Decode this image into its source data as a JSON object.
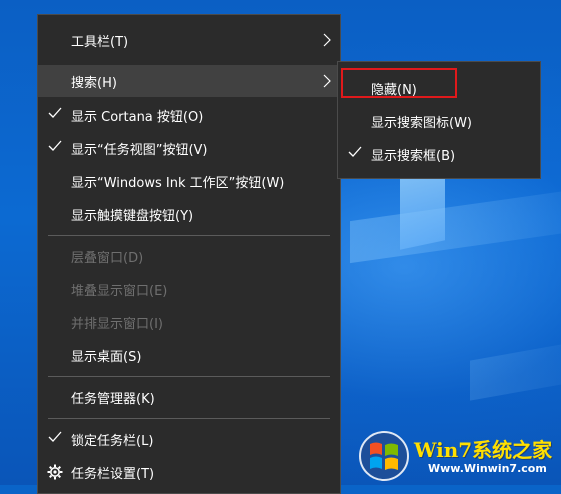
{
  "menu": {
    "items": [
      {
        "label": "工具栏(T)",
        "checked": false,
        "submenu": true,
        "disabled": false
      },
      {
        "label": "搜索(H)",
        "checked": false,
        "submenu": true,
        "disabled": false,
        "hovered": true
      },
      {
        "label": "显示 Cortana 按钮(O)",
        "checked": true,
        "submenu": false,
        "disabled": false
      },
      {
        "label": "显示“任务视图”按钮(V)",
        "checked": true,
        "submenu": false,
        "disabled": false
      },
      {
        "label": "显示“Windows Ink 工作区”按钮(W)",
        "checked": false,
        "submenu": false,
        "disabled": false
      },
      {
        "label": "显示触摸键盘按钮(Y)",
        "checked": false,
        "submenu": false,
        "disabled": false
      },
      {
        "label": "层叠窗口(D)",
        "checked": false,
        "submenu": false,
        "disabled": true
      },
      {
        "label": "堆叠显示窗口(E)",
        "checked": false,
        "submenu": false,
        "disabled": true
      },
      {
        "label": "并排显示窗口(I)",
        "checked": false,
        "submenu": false,
        "disabled": true
      },
      {
        "label": "显示桌面(S)",
        "checked": false,
        "submenu": false,
        "disabled": false
      },
      {
        "label": "任务管理器(K)",
        "checked": false,
        "submenu": false,
        "disabled": false
      },
      {
        "label": "锁定任务栏(L)",
        "checked": true,
        "submenu": false,
        "disabled": false
      },
      {
        "label": "任务栏设置(T)",
        "checked": false,
        "submenu": false,
        "disabled": false,
        "icon": "gear-icon"
      }
    ]
  },
  "submenu": {
    "items": [
      {
        "label": "隐藏(N)",
        "checked": false,
        "highlighted": true
      },
      {
        "label": "显示搜索图标(W)",
        "checked": false
      },
      {
        "label": "显示搜索框(B)",
        "checked": true
      }
    ]
  },
  "watermark": {
    "brand": "Win7系统之家",
    "url": "Www.Winwin7.com"
  },
  "colors": {
    "menu_bg": "#2b2b2b",
    "hover_bg": "#414141",
    "disabled_text": "#6f6f6f",
    "highlight_border": "#e0191b",
    "desktop_blue": "#0a64c8"
  }
}
